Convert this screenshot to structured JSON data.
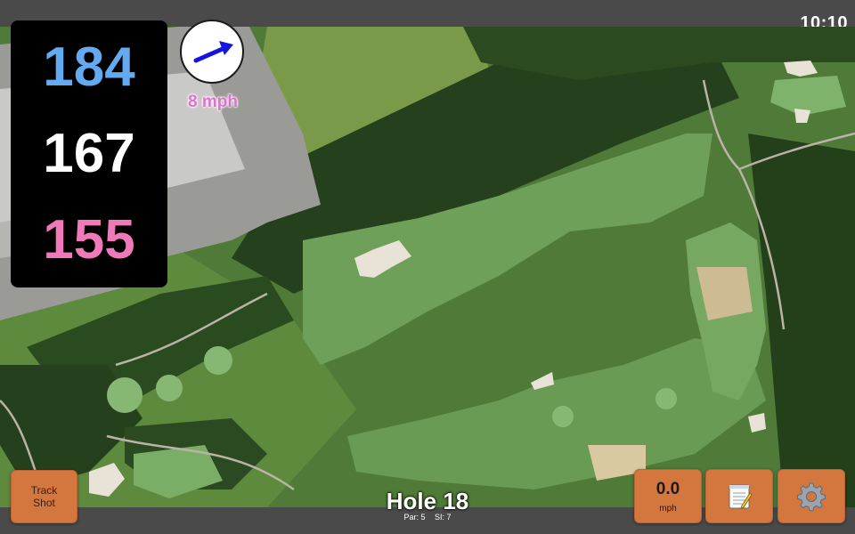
{
  "status_bar": {
    "time": "10:10"
  },
  "distances": {
    "back": "184",
    "middle": "167",
    "front": "155"
  },
  "wind": {
    "speed": "8 mph",
    "direction_icon": "wind-arrow-icon"
  },
  "hole": {
    "title": "Hole 18",
    "par": "Par: 5",
    "stroke_index": "SI: 7"
  },
  "buttons": {
    "track_shot": {
      "line1": "Track",
      "line2": "Shot"
    },
    "speed": {
      "value": "0.0",
      "unit": "mph"
    },
    "notes": {
      "icon": "notepad-icon"
    },
    "settings": {
      "icon": "gear-icon"
    }
  },
  "colors": {
    "back_distance": "#64aaf0",
    "middle_distance": "#ffffff",
    "front_distance": "#f07ab9",
    "button": "#d4773f",
    "wind_text": "#e070d0",
    "bars": "#4a4a4a"
  }
}
